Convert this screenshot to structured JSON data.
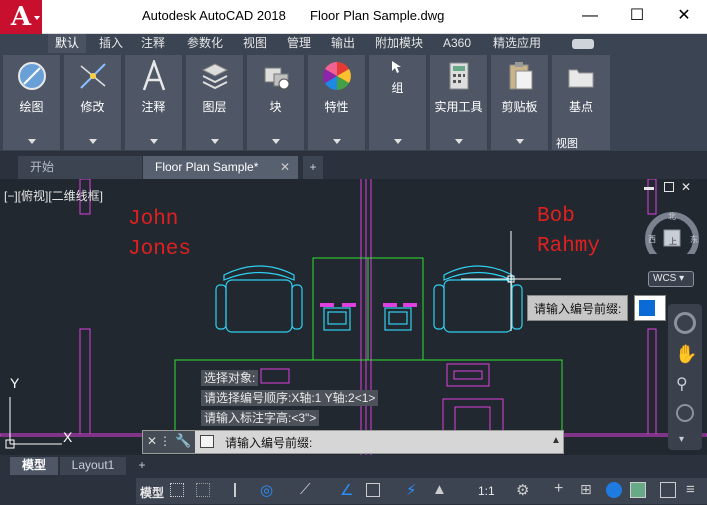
{
  "window": {
    "app_title": "Autodesk AutoCAD 2018",
    "document_title": "Floor Plan Sample.dwg",
    "app_button": "A",
    "minimize": "—",
    "maximize": "☐",
    "close": "✕"
  },
  "ribbon_tabs": [
    "默认",
    "插入",
    "注释",
    "参数化",
    "视图",
    "管理",
    "输出",
    "附加模块",
    "A360",
    "精选应用"
  ],
  "ribbon_panels": [
    "绘图",
    "修改",
    "注释",
    "图层",
    "块",
    "特性",
    "组",
    "实用工具",
    "剪贴板",
    "基点"
  ],
  "ribbon_view_label": "视图",
  "file_tabs": {
    "home": "开始",
    "doc": "Floor Plan Sample*",
    "add": "+"
  },
  "viewport_label": "[−][俯视][二维线框]",
  "drawing_text": {
    "name1_line1": "John",
    "name1_line2": "Jones",
    "name2_line1": "Bob",
    "name2_line2": "Rahmy"
  },
  "viewcube": {
    "north": "北",
    "south": "南",
    "west": "西",
    "east": "东",
    "top": "上",
    "wcs": "WCS"
  },
  "dynamic_input": {
    "prompt": "请输入编号前缀:"
  },
  "command_history": [
    "选择对象:",
    "请选择编号顺序:X轴:1 Y轴:2<1>",
    "请输入标注字高:<3\">"
  ],
  "command_line": {
    "text": "请输入编号前缀:",
    "prefix": "▸"
  },
  "layout_tabs": [
    "模型",
    "Layout1",
    "+"
  ],
  "status": {
    "model": "模型",
    "scale": "1:1"
  },
  "colors": {
    "wall": "#e040e0",
    "furniture": "#30d0f0",
    "room": "#30e030",
    "annotation": "#e02020",
    "background": "#212830"
  }
}
